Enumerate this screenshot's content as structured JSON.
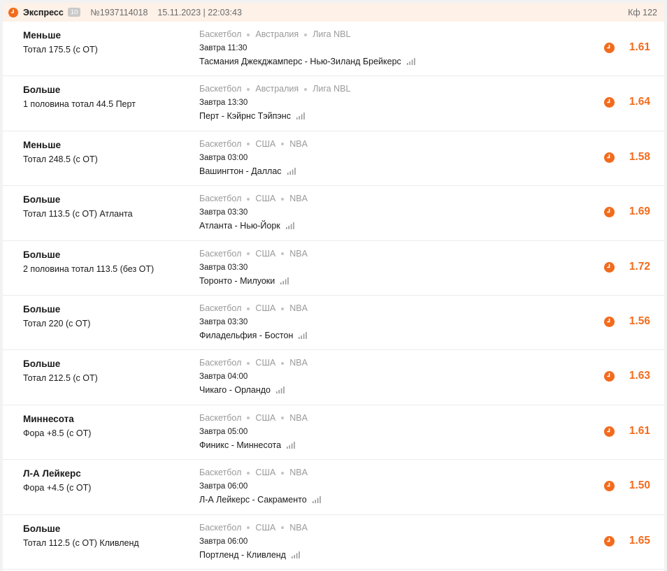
{
  "header": {
    "type": "Экспресс",
    "count": "10",
    "number": "№1937114018",
    "datetime": "15.11.2023 | 22:03:43",
    "coef": "Кф 122"
  },
  "colors": {
    "accent": "#f26b1d",
    "header_bg": "#fdf1e8"
  },
  "bets": [
    {
      "pick": "Меньше",
      "market": "Тотал 175.5 (с ОТ)",
      "sport": "Баскетбол",
      "country": "Австралия",
      "league": "Лига NBL",
      "time": "Завтра 11:30",
      "match": "Тасмания Джекджамперс - Нью-Зиланд Брейкерс",
      "odds": "1.61"
    },
    {
      "pick": "Больше",
      "market": "1 половина тотал 44.5 Перт",
      "sport": "Баскетбол",
      "country": "Австралия",
      "league": "Лига NBL",
      "time": "Завтра 13:30",
      "match": "Перт - Кэйрнс Тэйпэнс",
      "odds": "1.64"
    },
    {
      "pick": "Меньше",
      "market": "Тотал 248.5 (с ОТ)",
      "sport": "Баскетбол",
      "country": "США",
      "league": "NBA",
      "time": "Завтра 03:00",
      "match": "Вашингтон - Даллас",
      "odds": "1.58"
    },
    {
      "pick": "Больше",
      "market": "Тотал 113.5 (с ОТ) Атланта",
      "sport": "Баскетбол",
      "country": "США",
      "league": "NBA",
      "time": "Завтра 03:30",
      "match": "Атланта - Нью-Йорк",
      "odds": "1.69"
    },
    {
      "pick": "Больше",
      "market": "2 половина тотал 113.5 (без ОТ)",
      "sport": "Баскетбол",
      "country": "США",
      "league": "NBA",
      "time": "Завтра 03:30",
      "match": "Торонто - Милуоки",
      "odds": "1.72"
    },
    {
      "pick": "Больше",
      "market": "Тотал 220 (с ОТ)",
      "sport": "Баскетбол",
      "country": "США",
      "league": "NBA",
      "time": "Завтра 03:30",
      "match": "Филадельфия - Бостон",
      "odds": "1.56"
    },
    {
      "pick": "Больше",
      "market": "Тотал 212.5 (с ОТ)",
      "sport": "Баскетбол",
      "country": "США",
      "league": "NBA",
      "time": "Завтра 04:00",
      "match": "Чикаго - Орландо",
      "odds": "1.63"
    },
    {
      "pick": "Миннесота",
      "market": "Фора +8.5 (с ОТ)",
      "sport": "Баскетбол",
      "country": "США",
      "league": "NBA",
      "time": "Завтра 05:00",
      "match": "Финикс - Миннесота",
      "odds": "1.61"
    },
    {
      "pick": "Л-А Лейкерс",
      "market": "Фора +4.5 (с ОТ)",
      "sport": "Баскетбол",
      "country": "США",
      "league": "NBA",
      "time": "Завтра 06:00",
      "match": "Л-А Лейкерс - Сакраменто",
      "odds": "1.50"
    },
    {
      "pick": "Больше",
      "market": "Тотал 112.5 (с ОТ) Кливленд",
      "sport": "Баскетбол",
      "country": "США",
      "league": "NBA",
      "time": "Завтра 06:00",
      "match": "Портленд - Кливленд",
      "odds": "1.65"
    }
  ]
}
